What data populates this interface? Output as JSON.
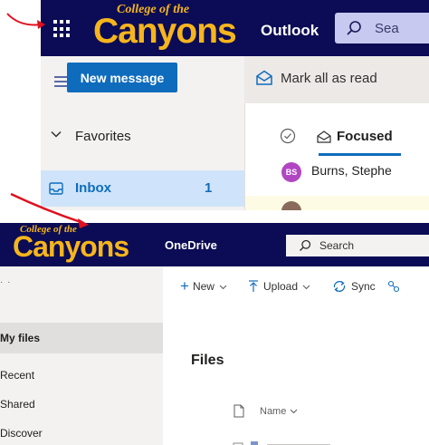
{
  "outlook": {
    "brand_small": "College of the",
    "brand_big": "Canyons",
    "app_name": "Outlook",
    "search_label": "Sea",
    "new_message_label": "New message",
    "mark_all_read_label": "Mark all as read",
    "favorites_label": "Favorites",
    "inbox_label": "Inbox",
    "inbox_count": "1",
    "focused_tab_label": "Focused",
    "message_avatar_initials": "BS",
    "message_sender": "Burns, Stephe"
  },
  "onedrive": {
    "brand_small": "College of the",
    "brand_big": "Canyons",
    "app_name": "OneDrive",
    "search_label": "Search",
    "commands": {
      "new_label": "New",
      "upload_label": "Upload",
      "sync_label": "Sync"
    },
    "nav": {
      "my_files": "My files",
      "recent": "Recent",
      "shared": "Shared",
      "discover": "Discover"
    },
    "files_title": "Files",
    "name_column": "Name"
  },
  "colors": {
    "header_navy": "#0b0c55",
    "brand_gold": "#f6b51d",
    "accent_blue": "#0f6cbd",
    "annotation_red": "#e0101e"
  },
  "icons": [
    "app-launcher-icon",
    "search-icon",
    "hamburger-icon",
    "envelope-open-icon",
    "chevron-down-icon",
    "inbox-icon",
    "select-all-check-icon",
    "focused-inbox-icon",
    "plus-icon",
    "upload-icon",
    "sync-icon",
    "file-icon",
    "red-arrow-annotation"
  ]
}
